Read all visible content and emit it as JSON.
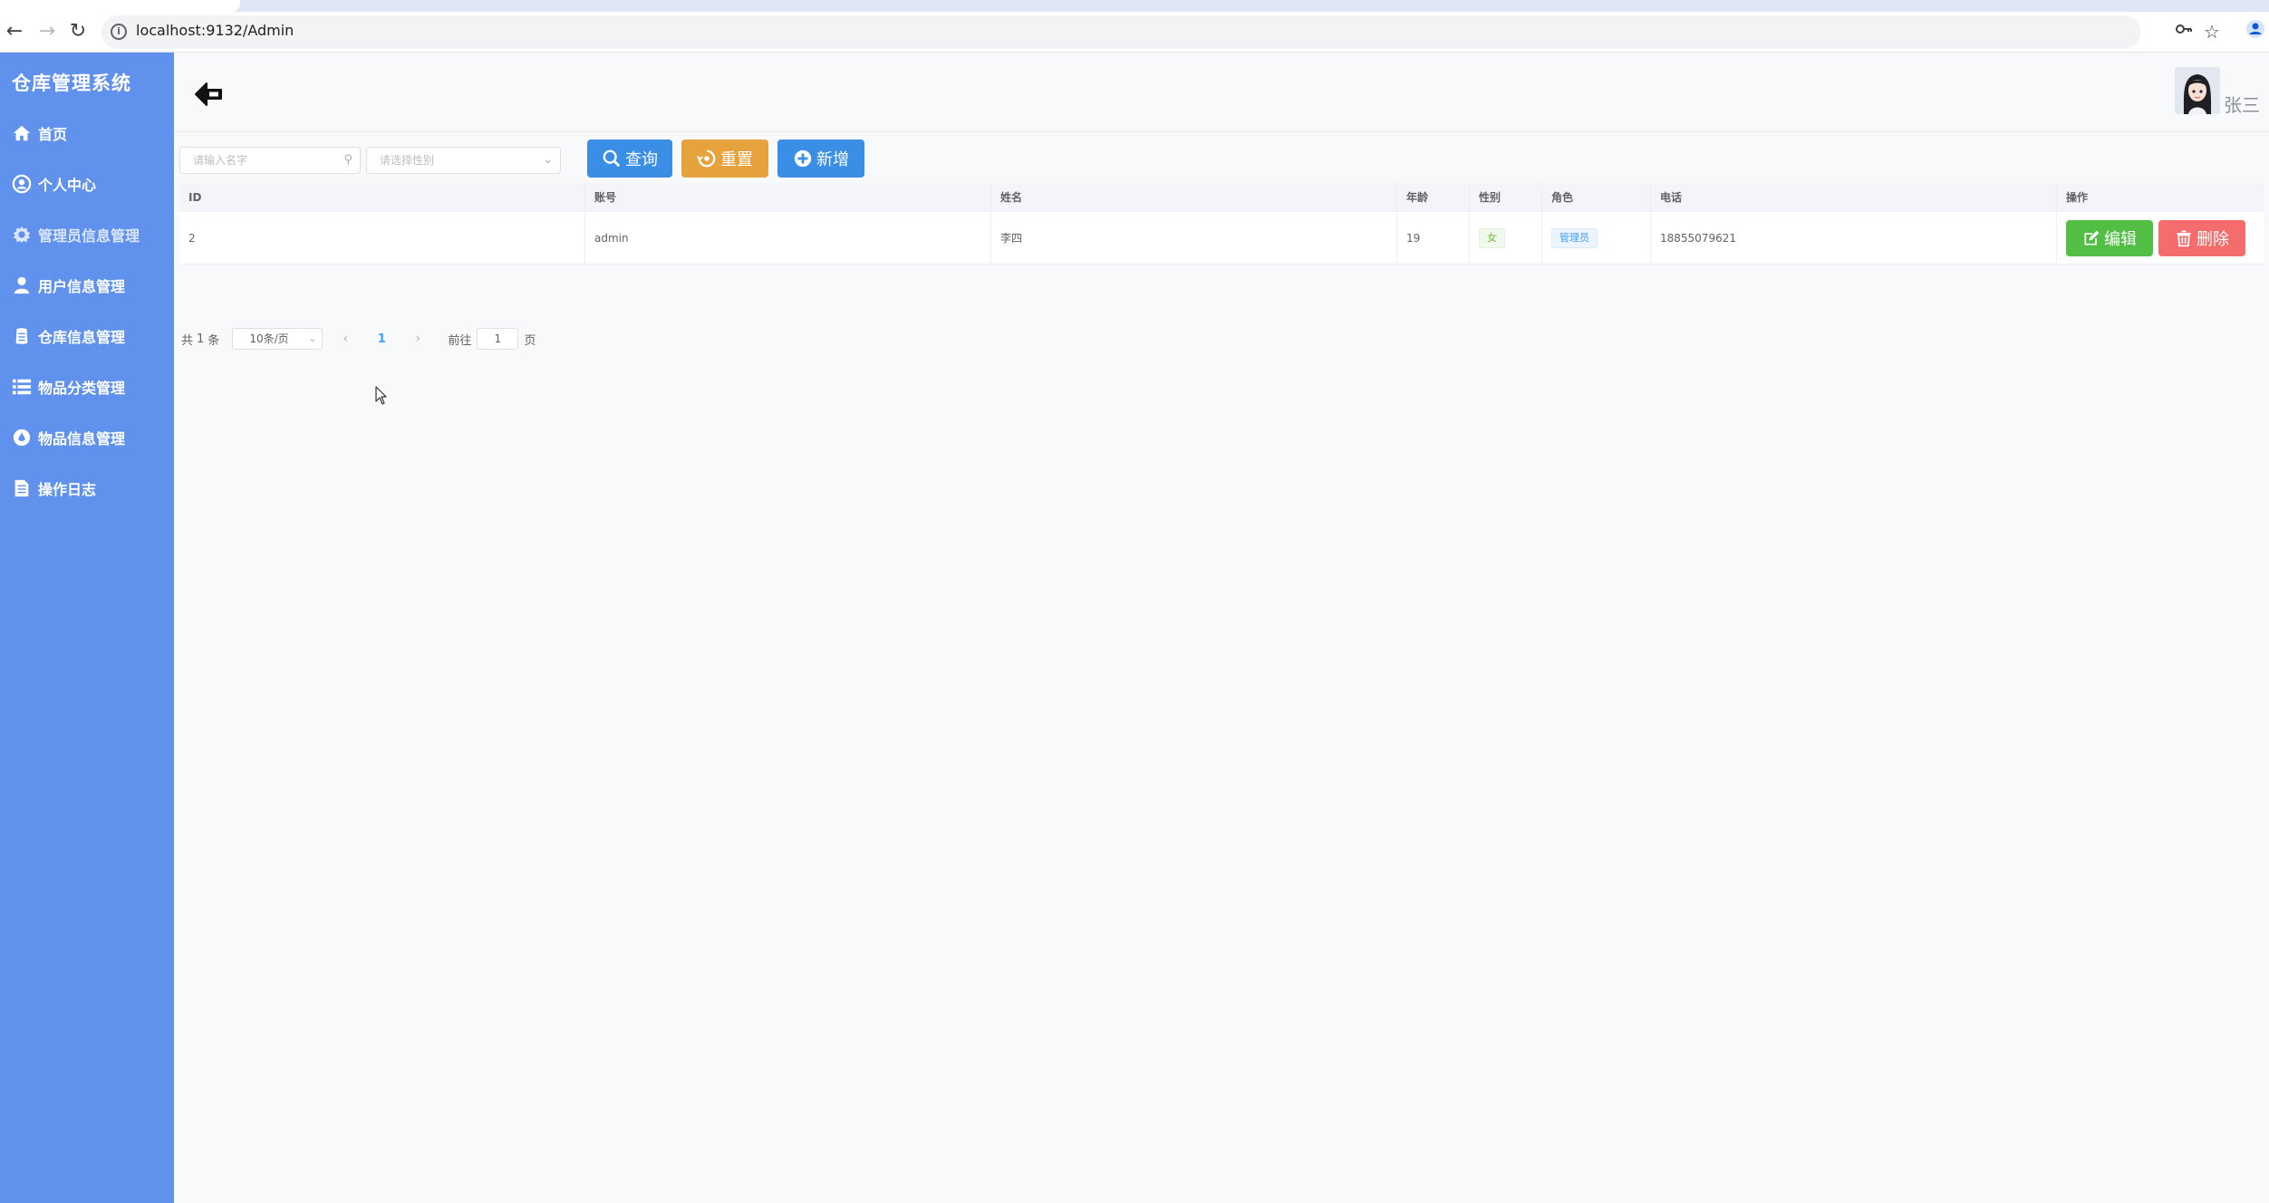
{
  "browser": {
    "tab_title": "",
    "url": "localhost:9132/Admin",
    "icons": {
      "back": "arrow-left-icon",
      "forward": "arrow-right-icon",
      "reload": "reload-icon",
      "info": "info-icon",
      "password": "key-icon",
      "bookmark": "star-icon",
      "profile": "profile-icon"
    }
  },
  "sidebar": {
    "brand": "仓库管理系统",
    "items": [
      {
        "label": "首页",
        "icon": "home-icon"
      },
      {
        "label": "个人中心",
        "icon": "user-circle-icon"
      },
      {
        "label": "管理员信息管理",
        "icon": "gear-icon"
      },
      {
        "label": "用户信息管理",
        "icon": "user-icon"
      },
      {
        "label": "仓库信息管理",
        "icon": "warehouse-icon"
      },
      {
        "label": "物品分类管理",
        "icon": "list-icon"
      },
      {
        "label": "物品信息管理",
        "icon": "drop-icon"
      },
      {
        "label": "操作日志",
        "icon": "document-icon"
      }
    ],
    "active_index": 2,
    "colors": {
      "background": "#5f91ed",
      "text": "#ffffff"
    }
  },
  "header": {
    "back_icon": "back-arrow-icon",
    "username": "张三"
  },
  "filters": {
    "name_placeholder": "请输入名字",
    "gender_placeholder": "请选择性别",
    "search_label": "查询",
    "reset_label": "重置",
    "add_label": "新增"
  },
  "table": {
    "columns": [
      "ID",
      "账号",
      "姓名",
      "年龄",
      "性别",
      "角色",
      "电话",
      "操作"
    ],
    "rows": [
      {
        "id": "2",
        "account": "admin",
        "name": "李四",
        "age": "19",
        "gender": "女",
        "role": "管理员",
        "phone": "18855079621",
        "edit_label": "编辑",
        "delete_label": "删除"
      }
    ]
  },
  "pagination": {
    "total_prefix": "共",
    "total": "1",
    "total_suffix": "条",
    "page_size": "10条/页",
    "current_page": "1",
    "goto_prefix": "前往",
    "goto_value": "1",
    "goto_suffix": "页"
  },
  "colors": {
    "primary": "#3a8ee6",
    "warning": "#e6a23c",
    "success": "#52be43",
    "danger": "#f56c6c"
  }
}
